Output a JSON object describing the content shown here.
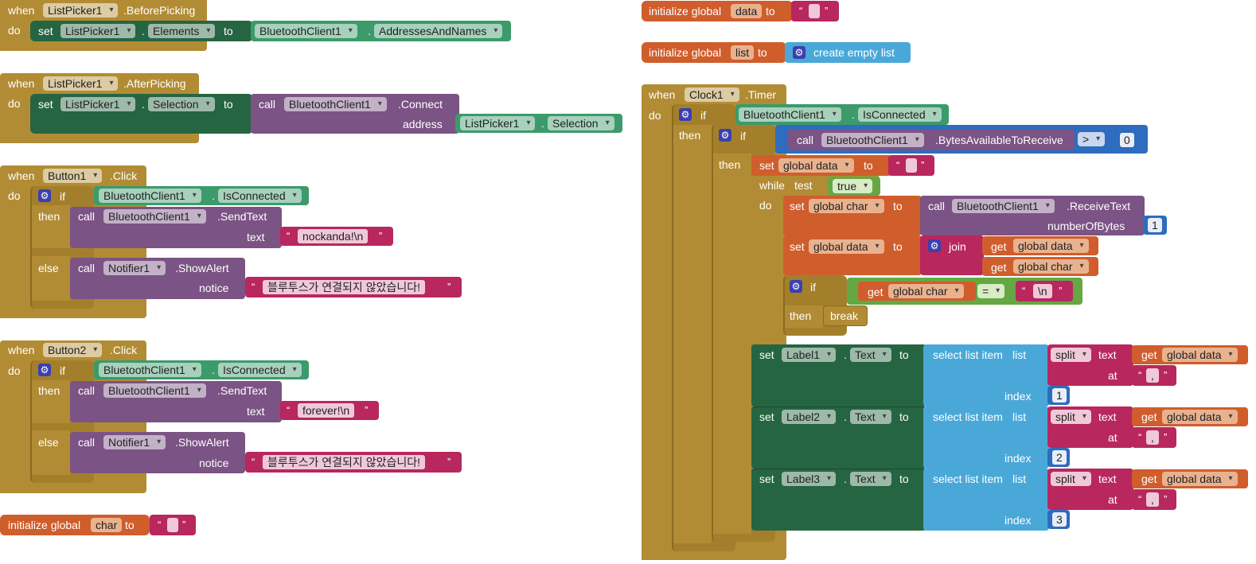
{
  "kw": {
    "when": "when",
    "do": "do",
    "set": "set",
    "to": "to",
    "call": "call",
    "if": "if",
    "then": "then",
    "else": "else",
    "init": "initialize global",
    "address": "address",
    "text": "text",
    "notice": "notice",
    "get": "get",
    "while": "while",
    "test": "test",
    "join": "join",
    "break": "break",
    "number_of_bytes": "numberOfBytes",
    "select": "select list item",
    "list": "list",
    "index": "index",
    "split": "split",
    "at": "at",
    "dot": ".",
    "lq": "“",
    "rq": "”",
    "gear": "⚙"
  },
  "comp": {
    "listpicker1": "ListPicker1",
    "bt": "BluetoothClient1",
    "button1": "Button1",
    "button2": "Button2",
    "notifier1": "Notifier1",
    "clock1": "Clock1",
    "label1": "Label1",
    "label2": "Label2",
    "label3": "Label3"
  },
  "ev": {
    "before": ".BeforePicking",
    "after": ".AfterPicking",
    "click": ".Click",
    "timer": ".Timer"
  },
  "prop": {
    "elements": "Elements",
    "addr": "AddressesAndNames",
    "selection": "Selection",
    "isconn": "IsConnected",
    "text": "Text"
  },
  "meth": {
    "connect": ".Connect",
    "sendtext": ".SendText",
    "showalert": ".ShowAlert",
    "bytes": ".BytesAvailableToReceive",
    "receive": ".ReceiveText"
  },
  "vars": {
    "data": "data",
    "list": "list",
    "char": "char",
    "gdata": "global data",
    "gchar": "global char"
  },
  "str": {
    "msg1": "nockanda!\\n",
    "msg2": "forever!\\n",
    "alert": "블루투스가 연결되지 않았습니다!",
    "newline": "\\n",
    "comma": ",",
    "empty": ""
  },
  "ops": {
    "gt": ">",
    "eq": "="
  },
  "nums": {
    "zero": "0",
    "one": "1",
    "two": "2",
    "three": "3"
  },
  "logic": {
    "true": "true"
  },
  "listops": {
    "create_empty": "create empty list"
  }
}
